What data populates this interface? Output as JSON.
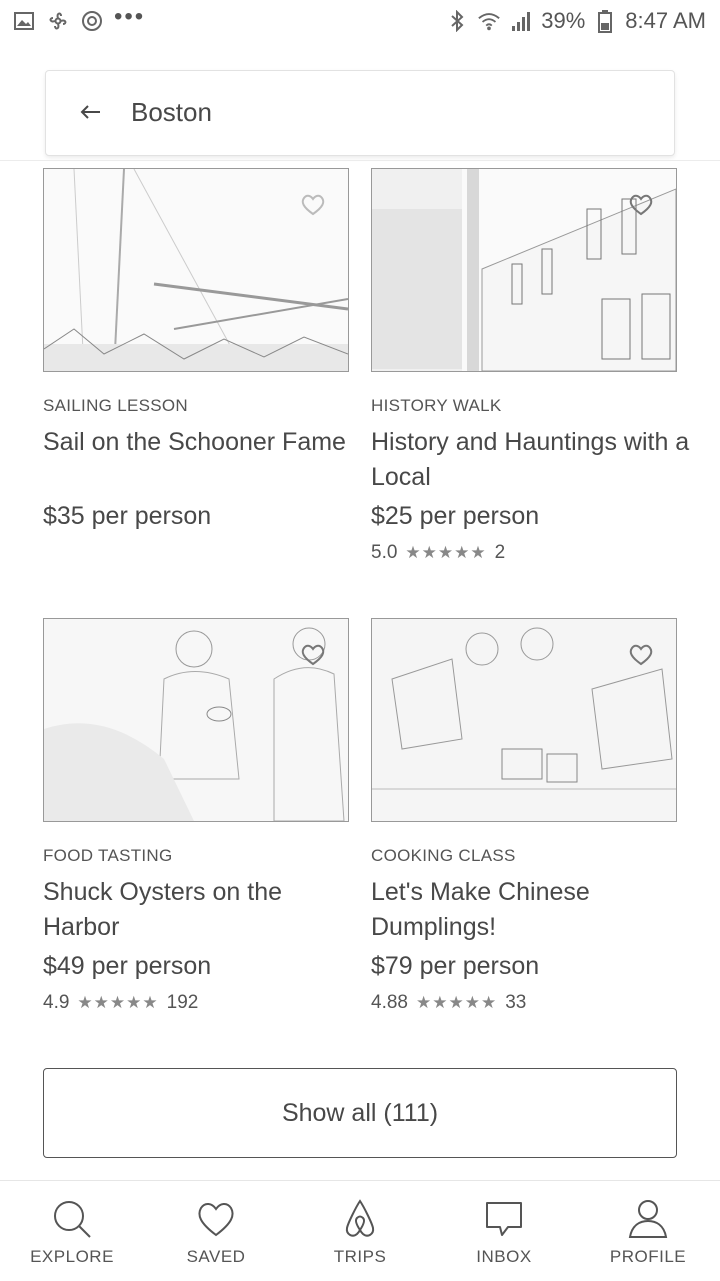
{
  "status_bar": {
    "battery": "39%",
    "time": "8:47 AM",
    "left_icons": [
      "image-icon",
      "fan-icon",
      "sync-icon",
      "more-dots-icon"
    ],
    "right_icons": [
      "bluetooth-icon",
      "wifi-icon",
      "signal-icon",
      "battery-icon"
    ]
  },
  "search": {
    "location": "Boston"
  },
  "experiences": [
    {
      "category": "SAILING LESSON",
      "title": "Sail on the Schooner Fame",
      "price": "$35 per person",
      "rating": "",
      "review_count": ""
    },
    {
      "category": "HISTORY WALK",
      "title": "History and Hauntings with a Local",
      "price": "$25 per person",
      "rating": "5.0",
      "stars": "★★★★★",
      "review_count": "2"
    },
    {
      "category": "FOOD TASTING",
      "title": "Shuck Oysters on the Harbor",
      "price": "$49 per person",
      "rating": "4.9",
      "stars": "★★★★★",
      "review_count": "192"
    },
    {
      "category": "COOKING CLASS",
      "title": "Let's Make Chinese Dumplings!",
      "price": "$79 per person",
      "rating": "4.88",
      "stars": "★★★★★",
      "review_count": "33"
    }
  ],
  "show_all_label": "Show all (111)",
  "bottom_nav": {
    "explore": "EXPLORE",
    "saved": "SAVED",
    "trips": "TRIPS",
    "inbox": "INBOX",
    "profile": "PROFILE"
  }
}
